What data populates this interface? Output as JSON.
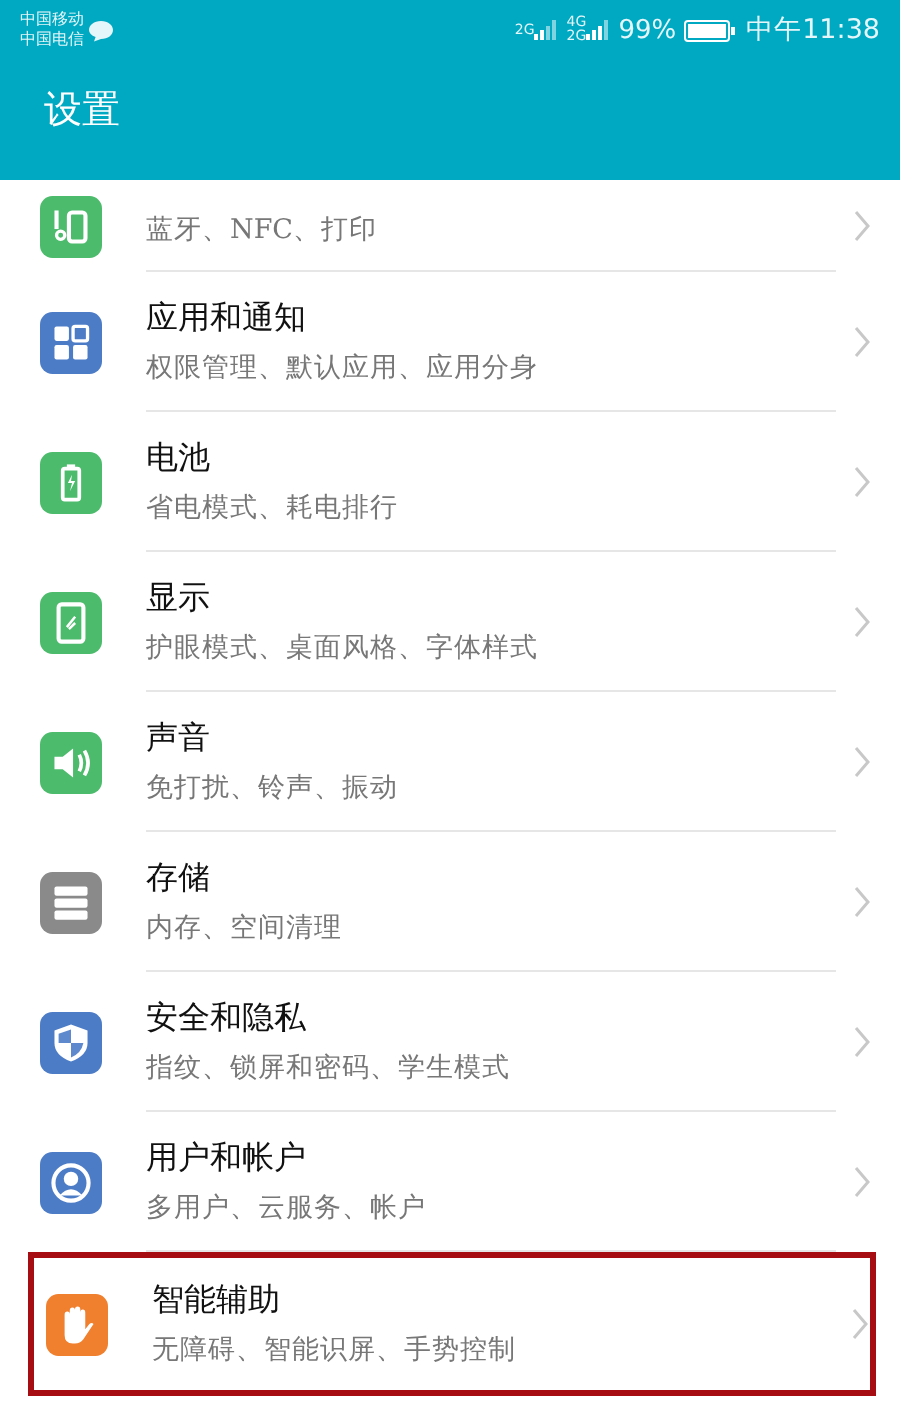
{
  "status_bar": {
    "carriers": [
      "中国移动",
      "中国电信"
    ],
    "network_1": "2G",
    "network_2": "4G",
    "network_3": "2G",
    "battery": "99%",
    "time": "中午11:38"
  },
  "app_bar": {
    "title": "设置"
  },
  "items": [
    {
      "subtitle": "蓝牙、NFC、打印",
      "kind": "device",
      "color": "#4cbb6c",
      "highlighted": false
    },
    {
      "title": "应用和通知",
      "subtitle": "权限管理、默认应用、应用分身",
      "kind": "apps",
      "color": "#4d7cc7",
      "highlighted": false
    },
    {
      "title": "电池",
      "subtitle": "省电模式、耗电排行",
      "kind": "battery",
      "color": "#4cbb6c",
      "highlighted": false
    },
    {
      "title": "显示",
      "subtitle": "护眼模式、桌面风格、字体样式",
      "kind": "display",
      "color": "#4cbb6c",
      "highlighted": false
    },
    {
      "title": "声音",
      "subtitle": "免打扰、铃声、振动",
      "kind": "sound",
      "color": "#4cbb6c",
      "highlighted": false
    },
    {
      "title": "存储",
      "subtitle": "内存、空间清理",
      "kind": "storage",
      "color": "#8a8a8a",
      "highlighted": false
    },
    {
      "title": "安全和隐私",
      "subtitle": "指纹、锁屏和密码、学生模式",
      "kind": "shield",
      "color": "#4d7cc7",
      "highlighted": false
    },
    {
      "title": "用户和帐户",
      "subtitle": "多用户、云服务、帐户",
      "kind": "user",
      "color": "#4d7cc7",
      "highlighted": false
    },
    {
      "title": "智能辅助",
      "subtitle": "无障碍、智能识屏、手势控制",
      "kind": "hand",
      "color": "#f07f2e",
      "highlighted": true
    }
  ]
}
